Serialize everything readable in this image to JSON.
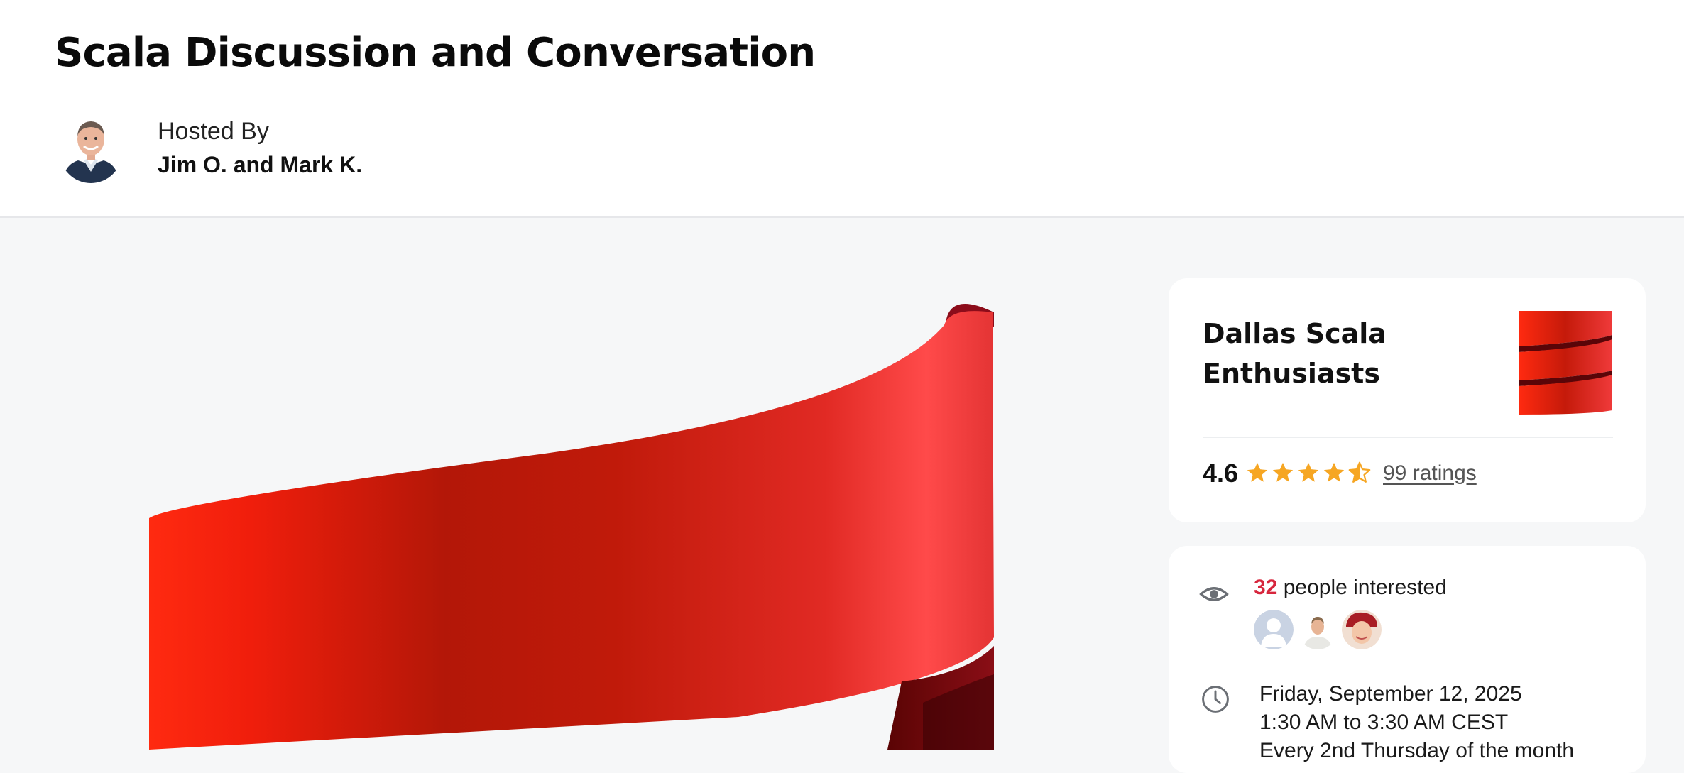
{
  "header": {
    "title": "Scala Discussion and Conversation",
    "hosted_label": "Hosted By",
    "hosts": "Jim O. and Mark K."
  },
  "group": {
    "name": "Dallas Scala Enthusiasts",
    "rating": "4.6",
    "rating_value": 4.5,
    "ratings_link": "99 ratings"
  },
  "details": {
    "interested_count": "32",
    "interested_text": " people interested",
    "date": "Friday, September 12, 2025",
    "time": "1:30 AM to 3:30 AM CEST",
    "recurrence": "Every 2nd Thursday of the month"
  },
  "icons": {
    "interest": "eye-icon",
    "time": "clock-icon",
    "rating": "star-icon"
  },
  "colors": {
    "accent_red": "#d7263d",
    "star": "#f6a623",
    "scala_red": "#de1f1f"
  }
}
